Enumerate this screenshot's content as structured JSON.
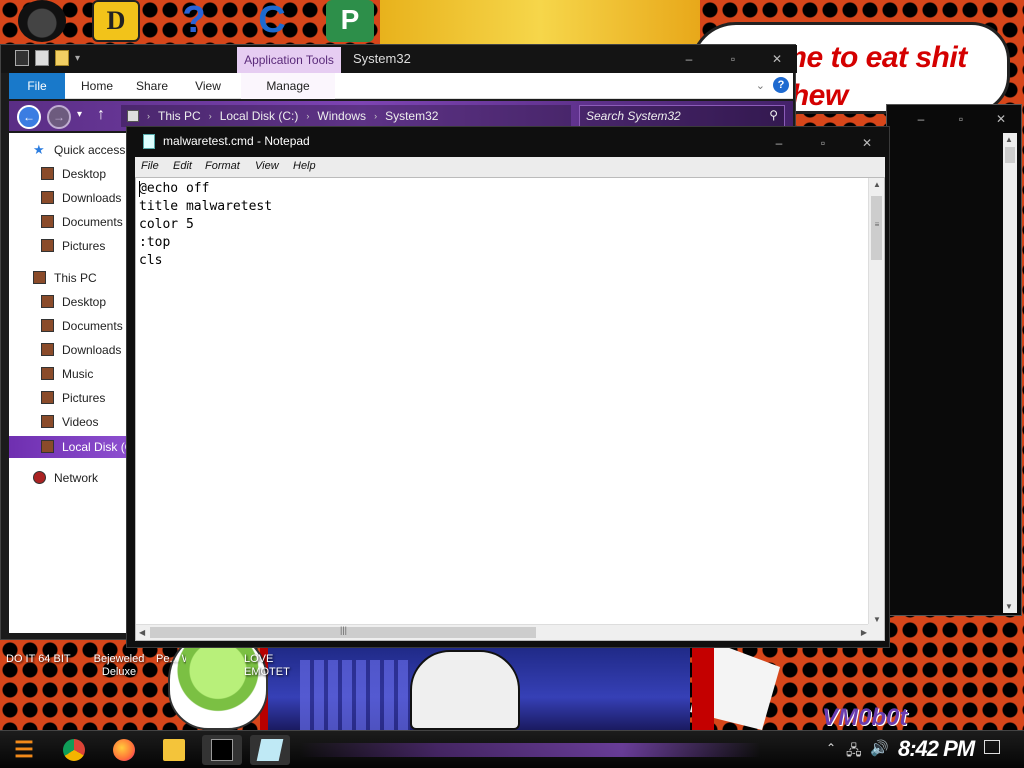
{
  "wallpaper": {
    "speech_bubble": "It's time to eat shit and chew",
    "watermark": "VM0b0t",
    "desktop_labels": [
      "DO IT 64 BIT",
      "Bejeweled Deluxe",
      "Pe... Wa...",
      "LOVE EMOTET"
    ]
  },
  "explorer": {
    "title": "System32",
    "context_tab": "Application Tools",
    "ribbon_tabs": {
      "file": "File",
      "home": "Home",
      "share": "Share",
      "view": "View",
      "manage": "Manage"
    },
    "breadcrumb": [
      "This PC",
      "Local Disk (C:)",
      "Windows",
      "System32"
    ],
    "search_placeholder": "Search System32",
    "nav": {
      "quick_access": "Quick access",
      "quick_items": [
        "Desktop",
        "Downloads",
        "Documents",
        "Pictures"
      ],
      "this_pc": "This PC",
      "pc_items": [
        "Desktop",
        "Documents",
        "Downloads",
        "Music",
        "Pictures",
        "Videos"
      ],
      "local_disk": "Local Disk (C:)",
      "network": "Network"
    }
  },
  "notepad": {
    "title": "malwaretest.cmd - Notepad",
    "menu": {
      "file": "File",
      "edit": "Edit",
      "format": "Format",
      "view": "View",
      "help": "Help"
    },
    "content": "@echo off\ntitle malwaretest\ncolor 5\n:top\ncls"
  },
  "taskbar": {
    "clock": "8:42 PM",
    "apps": [
      "chrome-icon",
      "firefox-icon",
      "file-explorer-icon",
      "cmd-icon",
      "notepad-icon"
    ]
  },
  "colors": {
    "accent_purple": "#7d44b3",
    "file_tab_blue": "#1979ca",
    "context_tab_bg": "#e6cdf2",
    "wallpaper_orange": "#d6461a"
  }
}
